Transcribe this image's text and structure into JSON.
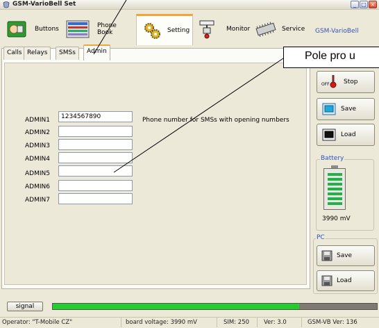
{
  "window": {
    "title": "GSM-VarioBell Set",
    "controls": [
      "_",
      "□",
      "×"
    ]
  },
  "toolbar": {
    "tabs": [
      {
        "label": "Buttons",
        "icon": "buttons-icon"
      },
      {
        "label": "Phone Book",
        "icon": "phone-book-icon"
      },
      {
        "label": "Setting",
        "icon": "gears-icon",
        "active": true
      },
      {
        "label": "Monitor",
        "icon": "monitor-icon"
      },
      {
        "label": "Service",
        "icon": "chip-icon"
      }
    ],
    "device_name": "GSM-VarioBell"
  },
  "subtabs": [
    "Calls",
    "Relays",
    "SMSs",
    "Admin"
  ],
  "admin": {
    "rows": [
      {
        "label": "ADMIN1",
        "value": "1234567890"
      },
      {
        "label": "ADMIN2",
        "value": ""
      },
      {
        "label": "ADMIN3",
        "value": ""
      },
      {
        "label": "ADMIN4",
        "value": ""
      },
      {
        "label": "ADMIN5",
        "value": ""
      },
      {
        "label": "ADMIN6",
        "value": ""
      },
      {
        "label": "ADMIN7",
        "value": ""
      }
    ],
    "hint": "Phone number for SMSs with opening numbers"
  },
  "callout": {
    "text": "Pole pro u"
  },
  "right_panel": {
    "stop_label": "Stop",
    "stop_off_label": "OFF",
    "save_label": "Save",
    "load_label": "Load",
    "battery_title": "Battery",
    "battery_voltage": "3990 mV",
    "pc_title": "PC",
    "pc_save_label": "Save",
    "pc_load_label": "Load"
  },
  "signal": {
    "button_label": "signal",
    "level_fraction": 0.76
  },
  "status": {
    "operator": "Operator: \"T-Mobile CZ\"",
    "board_voltage": "board voltage: 3990 mV",
    "sim": "SIM: 250",
    "ver": "Ver: 3.0",
    "gsm_ver": "GSM-VB Ver: 136"
  },
  "colors": {
    "accent_orange": "#f2a33a",
    "signal_green": "#21ce2d",
    "title_blue": "#2d51c8"
  }
}
